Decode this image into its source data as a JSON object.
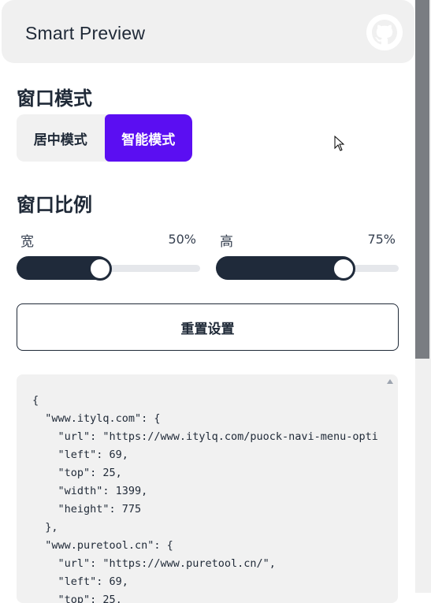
{
  "header": {
    "title": "Smart Preview",
    "github_icon": "github-icon"
  },
  "window_mode": {
    "title": "窗口模式",
    "options": [
      "居中模式",
      "智能模式"
    ],
    "selected": "智能模式",
    "accent": "#5b0ef2"
  },
  "window_ratio": {
    "title": "窗口比例",
    "width": {
      "label": "宽",
      "value_text": "50%",
      "value": 50
    },
    "height": {
      "label": "高",
      "value_text": "75%",
      "value": 75
    }
  },
  "reset_label": "重置设置",
  "config_json_lines": [
    "{",
    "  \"www.itylq.com\": {",
    "    \"url\": \"https://www.itylq.com/puock-navi-menu-opti",
    "    \"left\": 69,",
    "    \"top\": 25,",
    "    \"width\": 1399,",
    "    \"height\": 775",
    "  },",
    "  \"www.puretool.cn\": {",
    "    \"url\": \"https://www.puretool.cn/\",",
    "    \"left\": 69,",
    "    \"top\": 25,"
  ]
}
